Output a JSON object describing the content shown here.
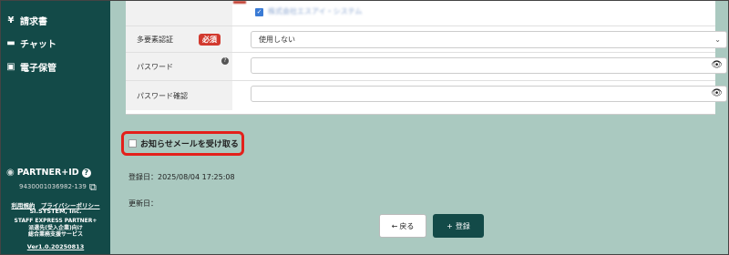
{
  "sidebar": {
    "items": [
      {
        "icon": "yen-icon",
        "glyph": "¥",
        "label": "請求書"
      },
      {
        "icon": "chat-icon",
        "glyph": "▬",
        "label": "チャット"
      },
      {
        "icon": "archive-icon",
        "glyph": "▣",
        "label": "電子保管"
      }
    ],
    "collapse_glyph": "‹",
    "partner_id_label": "PARTNER+ID",
    "partner_id_help": "?",
    "partner_id_number": "9430001036982-139",
    "terms_link": "利用規約",
    "privacy_link": "プライバシーポリシー",
    "company": "SI.SYSTEM, Inc.",
    "service_line1": "STAFF EXPRESS PARTNER+",
    "service_line2": "派遣先(受入企業)向け",
    "service_line3": "総合業務支援サービス",
    "version": "Ver1.0.20250813"
  },
  "form": {
    "top_checkbox_text": "株式会社エスアイ・システム",
    "mfa_label": "多要素認証",
    "mfa_required": "必須",
    "mfa_value": "使用しない",
    "password_label": "パスワード",
    "password_help": "?",
    "password_confirm_label": "パスワード確認"
  },
  "notify_label": "お知らせメールを受け取る",
  "registered_at": "登録日：2025/08/04 17:25:08",
  "updated_at": "更新日：",
  "buttons": {
    "back": "戻る",
    "back_glyph": "←",
    "register": "登録",
    "register_glyph": "+"
  },
  "colors": {
    "sidebar": "#134a48",
    "main_bg": "#aac9c0",
    "required": "#d23a2f",
    "highlight": "#e3201b"
  }
}
